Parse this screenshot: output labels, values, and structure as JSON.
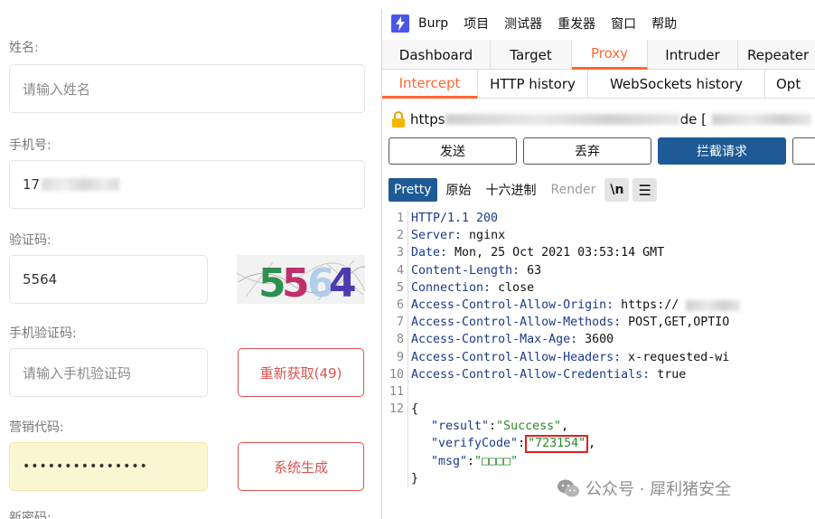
{
  "form": {
    "name_label": "姓名:",
    "name_placeholder": "请输入姓名",
    "phone_label": "手机号:",
    "phone_value_prefix": "17",
    "captcha_label": "验证码:",
    "captcha_value": "5564",
    "captcha_image_text": "5564",
    "sms_label": "手机验证码:",
    "sms_placeholder": "请输入手机验证码",
    "resend_button": "重新获取(49)",
    "marketing_label": "营销代码:",
    "marketing_value": "•••••••••••••••",
    "generate_button": "系统生成",
    "next_label_partial": "新密码:"
  },
  "burp": {
    "menu": [
      "Burp",
      "项目",
      "测试器",
      "重发器",
      "窗口",
      "帮助"
    ],
    "main_tabs": [
      "Dashboard",
      "Target",
      "Proxy",
      "Intruder",
      "Repeater"
    ],
    "active_main_tab": "Proxy",
    "proxy_tabs": [
      "Intercept",
      "HTTP history",
      "WebSockets history",
      "Opt"
    ],
    "active_proxy_tab": "Intercept",
    "url_start": "https",
    "url_mid": "de [",
    "buttons": [
      "发送",
      "丢弃",
      "拦截请求"
    ],
    "active_button": "拦截请求",
    "view_tabs": [
      "Pretty",
      "原始",
      "十六进制",
      "Render",
      "\\n",
      "☰"
    ],
    "active_view_tab": "Pretty",
    "response_lines": [
      {
        "n": "1",
        "name": "HTTP/1.1 200",
        "value": ""
      },
      {
        "n": "2",
        "name": "Server:",
        "value": " nginx"
      },
      {
        "n": "3",
        "name": "Date:",
        "value": " Mon, 25 Oct 2021 03:53:14 GMT"
      },
      {
        "n": "4",
        "name": "Content-Length:",
        "value": " 63"
      },
      {
        "n": "5",
        "name": "Connection:",
        "value": " close"
      },
      {
        "n": "6",
        "name": "Access-Control-Allow-Origin:",
        "value": " https://"
      },
      {
        "n": "7",
        "name": "Access-Control-Allow-Methods:",
        "value": " POST,GET,OPTIO"
      },
      {
        "n": "8",
        "name": "Access-Control-Max-Age:",
        "value": " 3600"
      },
      {
        "n": "9",
        "name": "Access-Control-Allow-Headers:",
        "value": " x-requested-wi"
      },
      {
        "n": "10",
        "name": "Access-Control-Allow-Credentials:",
        "value": " true"
      },
      {
        "n": "11",
        "name": "",
        "value": ""
      }
    ],
    "json_line_number": "12",
    "json_open": "{",
    "json_result_key": "\"result\"",
    "json_result_value": "\"Success\"",
    "json_verify_key": "\"verifyCode\"",
    "json_verify_value": "\"723154\"",
    "json_msg_key": "\"msg\"",
    "json_msg_value": "\"□□□□\"",
    "json_close": "}"
  },
  "watermark": "公众号 · 犀利猪安全"
}
